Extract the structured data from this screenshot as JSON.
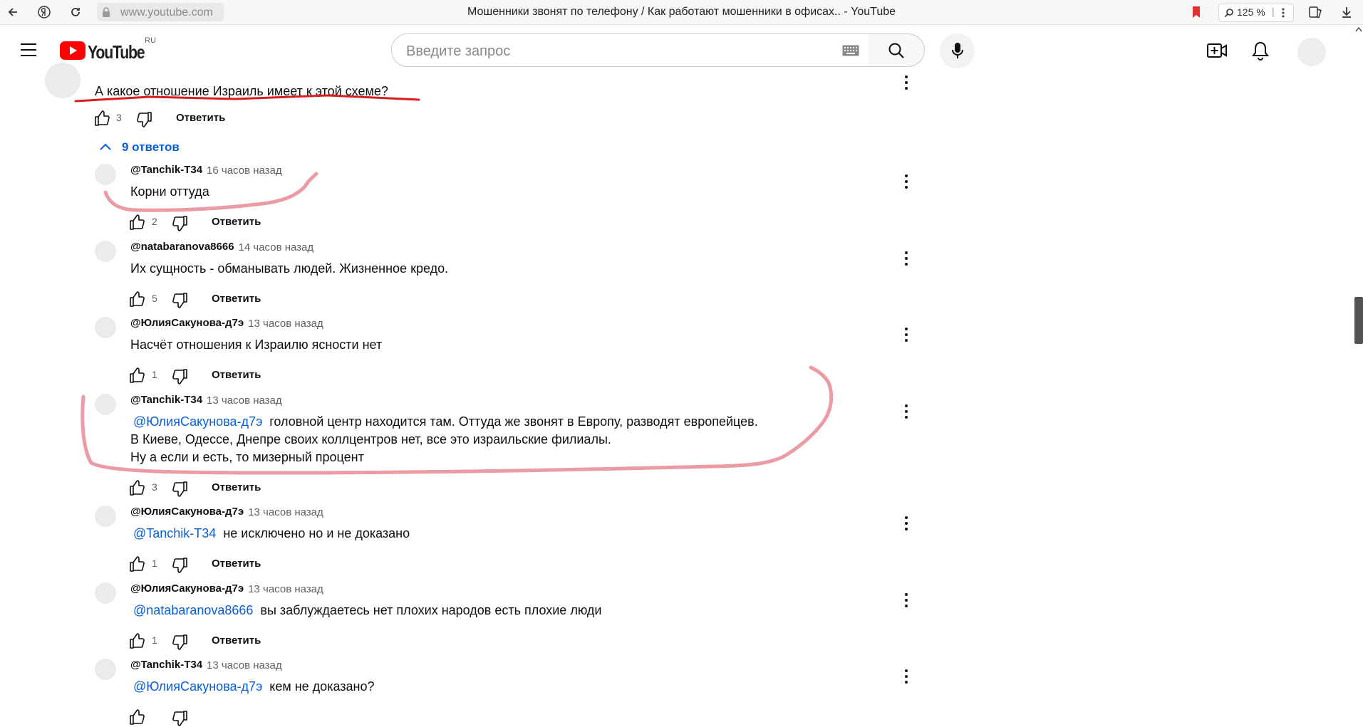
{
  "browser": {
    "url": "www.youtube.com",
    "tab_title": "Мошенники звонят по телефону / Как работают мошенники в офисах.. - YouTube",
    "zoom": "125 %"
  },
  "header": {
    "logo_text": "YouTube",
    "region": "RU",
    "search_placeholder": "Введите запрос"
  },
  "parent_comment": {
    "text": "А какое отношение Израиль имеет к этой схеме?",
    "likes": "3",
    "reply_label": "Ответить"
  },
  "replies_toggle": "9 ответов",
  "replies": [
    {
      "author": "@Tanchik-T34",
      "time": "16 часов назад",
      "mention": "",
      "lines": [
        "Корни оттуда"
      ],
      "likes": "2",
      "reply_label": "Ответить"
    },
    {
      "author": "@natabaranova8666",
      "time": "14 часов назад",
      "mention": "",
      "lines": [
        "Их сущность - обманывать людей. Жизненное кредо."
      ],
      "likes": "5",
      "reply_label": "Ответить"
    },
    {
      "author": "@ЮлияСакунова-д7э",
      "time": "13 часов назад",
      "mention": "",
      "lines": [
        "Насчёт отношения к Израилю ясности нет"
      ],
      "likes": "1",
      "reply_label": "Ответить"
    },
    {
      "author": "@Tanchik-T34",
      "time": "13 часов назад",
      "mention": "@ЮлияСакунова-д7э",
      "lines": [
        "головной центр находится там. Оттуда же звонят в Европу, разводят европейцев.",
        "В Киеве, Одессе, Днепре своих коллцентров нет, все это израильские филиалы.",
        "Ну а если и есть, то мизерный процент"
      ],
      "likes": "3",
      "reply_label": "Ответить"
    },
    {
      "author": "@ЮлияСакунова-д7э",
      "time": "13 часов назад",
      "mention": "@Tanchik-T34",
      "lines": [
        "не исключено но и не доказано"
      ],
      "likes": "1",
      "reply_label": "Ответить"
    },
    {
      "author": "@ЮлияСакунова-д7э",
      "time": "13 часов назад",
      "mention": "@natabaranova8666",
      "lines": [
        "вы заблуждаетесь нет плохих народов есть плохие люди"
      ],
      "likes": "1",
      "reply_label": "Ответить"
    },
    {
      "author": "@Tanchik-T34",
      "time": "13 часов назад",
      "mention": "@ЮлияСакунова-д7э",
      "lines": [
        "кем не доказано?"
      ],
      "likes": "",
      "reply_label": ""
    }
  ],
  "colors": {
    "accent_link": "#065fd4",
    "logo_red": "#ff0000",
    "annotation_red": "#d81e1e",
    "annotation_pink": "#e88a93"
  }
}
